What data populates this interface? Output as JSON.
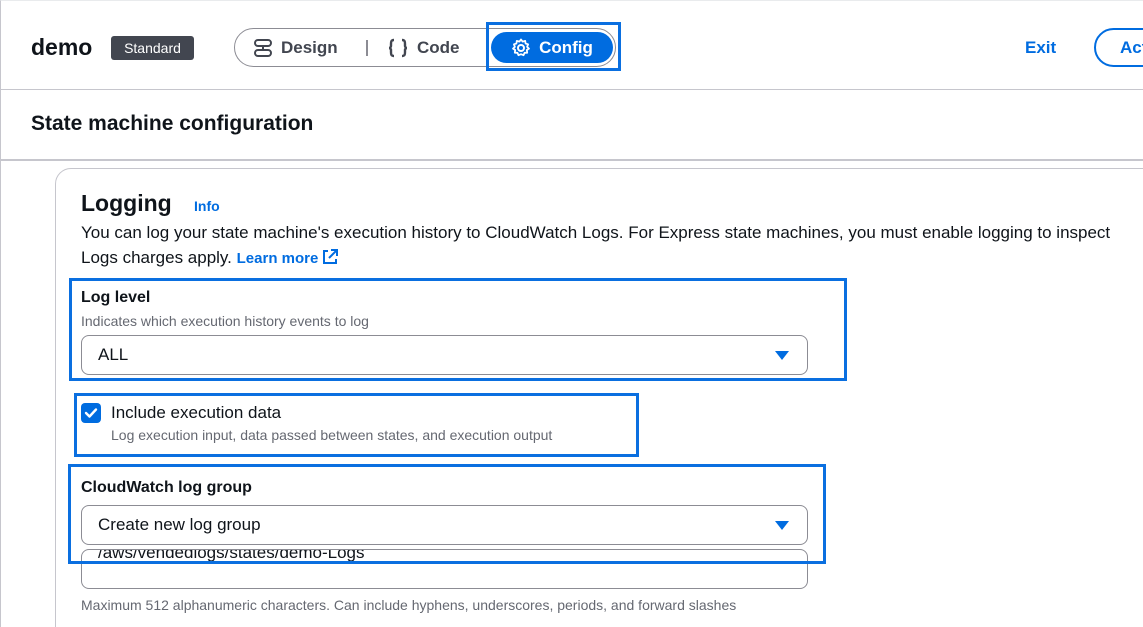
{
  "header": {
    "app_name": "demo",
    "badge": "Standard",
    "modes": [
      {
        "label": "Design",
        "icon": "design-icon"
      },
      {
        "label": "Code",
        "icon": "code-braces-icon"
      },
      {
        "label": "Config",
        "icon": "gear-icon",
        "selected": true
      }
    ],
    "exit_label": "Exit",
    "actions_label": "Actions"
  },
  "section": {
    "title": "State machine configuration"
  },
  "logging": {
    "title": "Logging",
    "info": "Info",
    "description_line1": "You can log your state machine's execution history to CloudWatch Logs. For Express state machines, you must enable logging to inspect",
    "description_line2": "Logs charges apply.",
    "learn_more": "Learn more",
    "log_level": {
      "label": "Log level",
      "hint": "Indicates which execution history events to log",
      "value": "ALL"
    },
    "include_execution_data": {
      "checked": true,
      "label": "Include execution data",
      "hint": "Log execution input, data passed between states, and execution output"
    },
    "log_group": {
      "label": "CloudWatch log group",
      "value": "Create new log group",
      "name_value": "/aws/vendedlogs/states/demo-Logs",
      "constraint": "Maximum 512 alphanumeric characters. Can include hyphens, underscores, periods, and forward slashes"
    }
  },
  "colors": {
    "accent": "#006ce0",
    "highlight": "#0a6fe0",
    "badge_bg": "#424650"
  }
}
